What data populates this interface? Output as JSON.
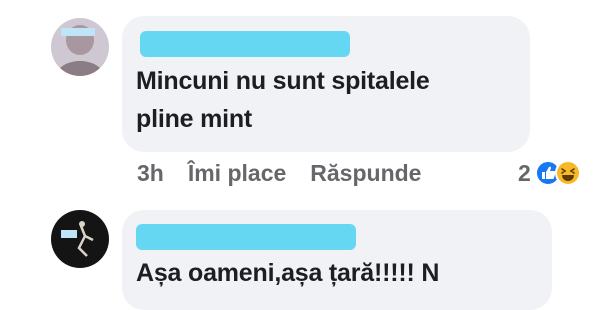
{
  "comments": [
    {
      "text_lines": [
        "Mincuni nu sunt spitalele",
        "pline mint"
      ],
      "time": "3h",
      "like_label": "Îmi place",
      "reply_label": "Răspunde",
      "reaction_count": "2",
      "reactions": [
        "like-icon",
        "haha-icon"
      ]
    },
    {
      "text": "Așa oameni,așa țară!!!!! N"
    }
  ],
  "colors": {
    "bubble": "#f0f2f5",
    "redaction": "#66d7f3",
    "text": "#1c1e21",
    "meta": "#65676b",
    "like": "#1877f2",
    "haha": "#f7b928"
  }
}
